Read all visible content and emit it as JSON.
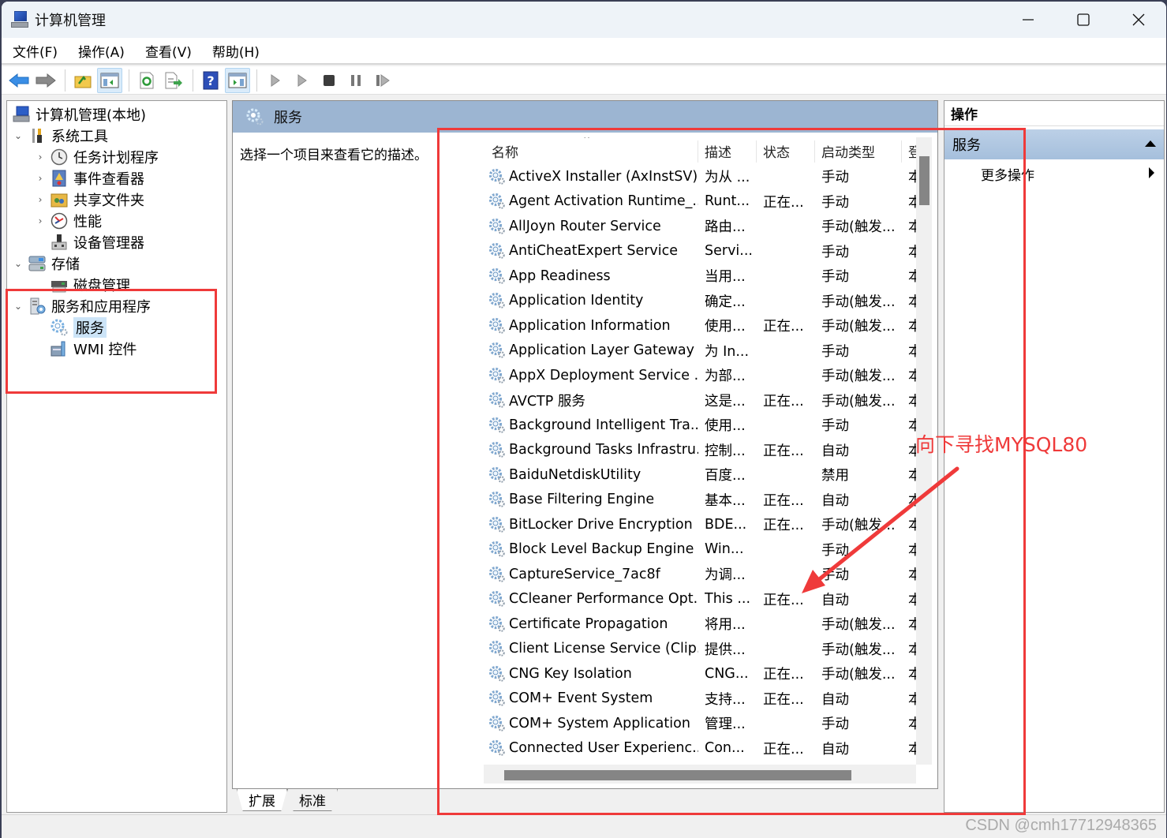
{
  "window": {
    "title": "计算机管理",
    "controls": {
      "minimize": "minimize",
      "maximize": "maximize",
      "close": "close"
    }
  },
  "menu": [
    "文件(F)",
    "操作(A)",
    "查看(V)",
    "帮助(H)"
  ],
  "toolbar": {
    "buttons": [
      "back-arrow",
      "forward-arrow",
      "up-folder",
      "show-hide-console-tree",
      "refresh",
      "export-list",
      "help",
      "show-hide-action-pane",
      "start-service",
      "start-service-alt",
      "stop-service",
      "pause-service",
      "restart-service"
    ]
  },
  "tree": {
    "root": "计算机管理(本地)",
    "items": [
      {
        "label": "系统工具",
        "level": 1,
        "expanded": true
      },
      {
        "label": "任务计划程序",
        "level": 2,
        "expandable": true
      },
      {
        "label": "事件查看器",
        "level": 2,
        "expandable": true
      },
      {
        "label": "共享文件夹",
        "level": 2,
        "expandable": true
      },
      {
        "label": "性能",
        "level": 2,
        "expandable": true
      },
      {
        "label": "设备管理器",
        "level": 2,
        "expandable": false
      },
      {
        "label": "存储",
        "level": 1,
        "expanded": true
      },
      {
        "label": "磁盘管理",
        "level": 2,
        "expandable": false
      },
      {
        "label": "服务和应用程序",
        "level": 1,
        "expanded": true
      },
      {
        "label": "服务",
        "level": 2,
        "selected": true
      },
      {
        "label": "WMI 控件",
        "level": 2
      }
    ]
  },
  "center": {
    "header": "服务",
    "description_prompt": "选择一个项目来查看它的描述。",
    "columns": [
      "名称",
      "描述",
      "状态",
      "启动类型",
      "登"
    ],
    "rows": [
      {
        "name": "ActiveX Installer (AxInstSV)",
        "desc": "为从 ...",
        "status": "",
        "startup": "手动",
        "logon": "本"
      },
      {
        "name": "Agent Activation Runtime_...",
        "desc": "Runt...",
        "status": "正在...",
        "startup": "手动",
        "logon": "本"
      },
      {
        "name": "AllJoyn Router Service",
        "desc": "路由...",
        "status": "",
        "startup": "手动(触发...",
        "logon": "本"
      },
      {
        "name": "AntiCheatExpert Service",
        "desc": "Servi...",
        "status": "",
        "startup": "手动",
        "logon": "本"
      },
      {
        "name": "App Readiness",
        "desc": "当用...",
        "status": "",
        "startup": "手动",
        "logon": "本"
      },
      {
        "name": "Application Identity",
        "desc": "确定...",
        "status": "",
        "startup": "手动(触发...",
        "logon": "本"
      },
      {
        "name": "Application Information",
        "desc": "使用...",
        "status": "正在...",
        "startup": "手动(触发...",
        "logon": "本"
      },
      {
        "name": "Application Layer Gateway ...",
        "desc": "为 In...",
        "status": "",
        "startup": "手动",
        "logon": "本"
      },
      {
        "name": "AppX Deployment Service ...",
        "desc": "为部...",
        "status": "",
        "startup": "手动(触发...",
        "logon": "本"
      },
      {
        "name": "AVCTP 服务",
        "desc": "这是...",
        "status": "正在...",
        "startup": "手动(触发...",
        "logon": "本"
      },
      {
        "name": "Background Intelligent Tra...",
        "desc": "使用...",
        "status": "",
        "startup": "手动",
        "logon": "本"
      },
      {
        "name": "Background Tasks Infrastru...",
        "desc": "控制...",
        "status": "正在...",
        "startup": "自动",
        "logon": "本"
      },
      {
        "name": "BaiduNetdiskUtility",
        "desc": "百度...",
        "status": "",
        "startup": "禁用",
        "logon": "本"
      },
      {
        "name": "Base Filtering Engine",
        "desc": "基本...",
        "status": "正在...",
        "startup": "自动",
        "logon": "本"
      },
      {
        "name": "BitLocker Drive Encryption ...",
        "desc": "BDE...",
        "status": "正在...",
        "startup": "手动(触发...",
        "logon": "本"
      },
      {
        "name": "Block Level Backup Engine ...",
        "desc": "Win...",
        "status": "",
        "startup": "手动",
        "logon": "本"
      },
      {
        "name": "CaptureService_7ac8f",
        "desc": "为调...",
        "status": "",
        "startup": "手动",
        "logon": "本"
      },
      {
        "name": "CCleaner Performance Opt...",
        "desc": "This ...",
        "status": "正在...",
        "startup": "自动",
        "logon": "本"
      },
      {
        "name": "Certificate Propagation",
        "desc": "将用...",
        "status": "",
        "startup": "手动(触发...",
        "logon": "本"
      },
      {
        "name": "Client License Service (Clip...",
        "desc": "提供...",
        "status": "",
        "startup": "手动(触发...",
        "logon": "本"
      },
      {
        "name": "CNG Key Isolation",
        "desc": "CNG...",
        "status": "正在...",
        "startup": "手动(触发...",
        "logon": "本"
      },
      {
        "name": "COM+ Event System",
        "desc": "支持...",
        "status": "正在...",
        "startup": "自动",
        "logon": "本"
      },
      {
        "name": "COM+ System Application",
        "desc": "管理...",
        "status": "",
        "startup": "手动",
        "logon": "本"
      },
      {
        "name": "Connected User Experienc...",
        "desc": "Con...",
        "status": "正在...",
        "startup": "自动",
        "logon": "本"
      }
    ],
    "tabs": [
      {
        "label": "扩展",
        "active": true
      },
      {
        "label": "标准",
        "active": false
      }
    ]
  },
  "actions": {
    "title": "操作",
    "section": "服务",
    "items": [
      "更多操作"
    ]
  },
  "annotation": {
    "text": "向下寻找MYSQL80",
    "color": "#ef3a3a"
  },
  "watermark": "CSDN @cmh17712948365"
}
